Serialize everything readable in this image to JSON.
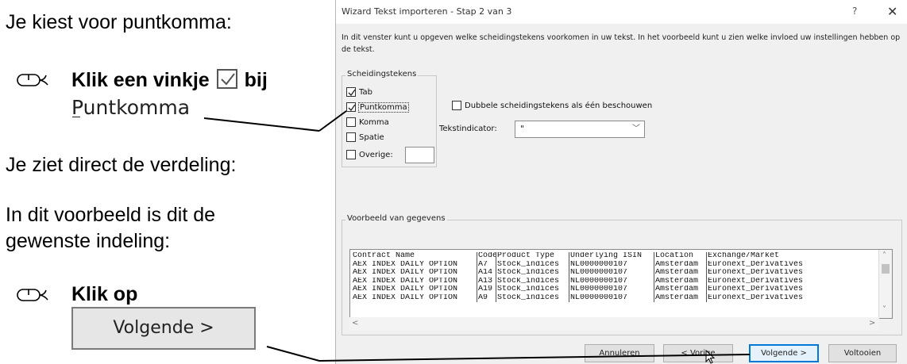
{
  "tutorial": {
    "line1": "Je kiest voor puntkomma:",
    "step1_prefix": "Klik een vinkje",
    "step1_suffix": "bij",
    "step1_target": "Puntkomma",
    "line2": "Je ziet direct de verdeling:",
    "line3a": "In dit voorbeeld is dit de",
    "line3b": "gewenste indeling:",
    "step2": "Klik op",
    "step2_button": "Volgende >",
    "mouse_icon": "mouse-icon"
  },
  "dialog": {
    "title": "Wizard Tekst importeren - Stap 2 van 3",
    "help": "?",
    "close": "✕",
    "intro": "In dit venster kunt u opgeven welke scheidingstekens voorkomen in uw tekst. In het voorbeeld kunt u zien welke invloed uw instellingen hebben op de tekst.",
    "delimiters_legend": "Scheidingstekens",
    "delimiters": [
      {
        "label": "Tab",
        "checked": true
      },
      {
        "label": "Puntkomma",
        "checked": true
      },
      {
        "label": "Komma",
        "checked": false
      },
      {
        "label": "Spatie",
        "checked": false
      },
      {
        "label": "Overige:",
        "checked": false
      }
    ],
    "double_delimiters": "Dubbele scheidingstekens als één beschouwen",
    "text_qualifier_label": "Tekstindicator:",
    "text_qualifier_value": "\"",
    "preview_legend": "Voorbeeld van gegevens",
    "preview": {
      "rows": [
        [
          "Contract Name",
          "Code",
          "Product Type",
          "Underlying ISIN",
          "Location",
          "Exchange/Market"
        ],
        [
          "AEX INDEX DAILY OPTION",
          "A7",
          "Stock_indices",
          "NL0000000107",
          "Amsterdam",
          "Euronext_Derivatives"
        ],
        [
          "AEX INDEX DAILY OPTION",
          "A14",
          "Stock_indices",
          "NL0000000107",
          "Amsterdam",
          "Euronext_Derivatives"
        ],
        [
          "AEX INDEX DAILY OPTION",
          "A13",
          "Stock_indices",
          "NL0000000107",
          "Amsterdam",
          "Euronext_Derivatives"
        ],
        [
          "AEX INDEX DAILY OPTION",
          "A19",
          "Stock_indices",
          "NL0000000107",
          "Amsterdam",
          "Euronext_Derivatives"
        ],
        [
          "AEX INDEX DAILY OPTION",
          "A9",
          "Stock_indices",
          "NL0000000107",
          "Amsterdam",
          "Euronext_Derivatives"
        ]
      ]
    },
    "buttons": {
      "cancel": "Annuleren",
      "back": "< Vorige",
      "next": "Volgende >",
      "finish": "Voltooien"
    }
  },
  "colors": {
    "accent": "#0078d7",
    "dialog_bg": "#f0f0f0",
    "connector": "#000000"
  }
}
